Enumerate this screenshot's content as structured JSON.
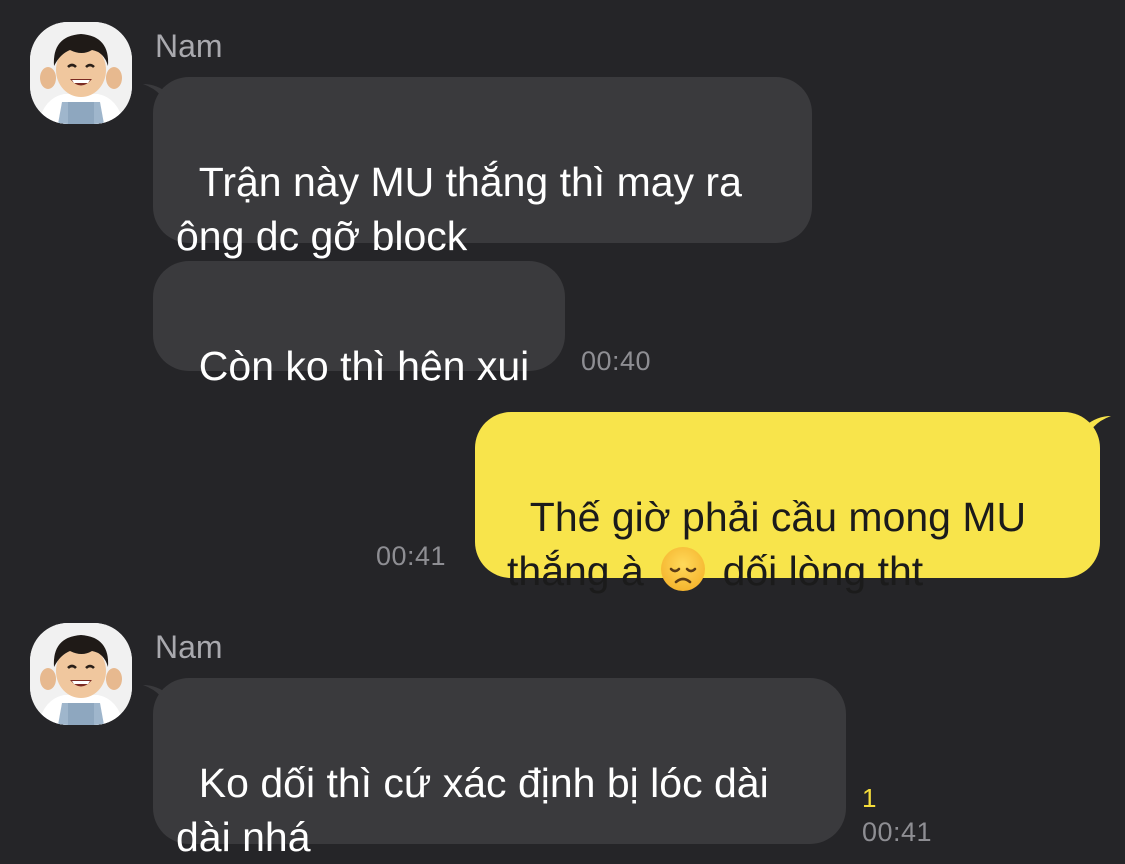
{
  "messages": [
    {
      "sender": "Nam",
      "text": "Trận này MU thắng thì may ra\nông dc gỡ block"
    },
    {
      "text": "Còn ko thì hên xui",
      "time": "00:40"
    },
    {
      "text_before_emoji": "Thế giờ phải cầu mong MU\nthắng à ",
      "emoji": "disappointed-face-icon",
      "text_after_emoji": " dối lòng tht",
      "time": "00:41"
    },
    {
      "sender": "Nam",
      "text": "Ko dối thì cứ xác định bị lóc dài\ndài nhá",
      "unread_count": "1",
      "time": "00:41"
    }
  ],
  "colors": {
    "background": "#252528",
    "incoming_bubble": "#3a3a3d",
    "outgoing_bubble": "#f8e44b",
    "sender_name": "#a9a9ae",
    "timestamp": "#8e8e93",
    "unread_badge": "#f5dd3b"
  }
}
